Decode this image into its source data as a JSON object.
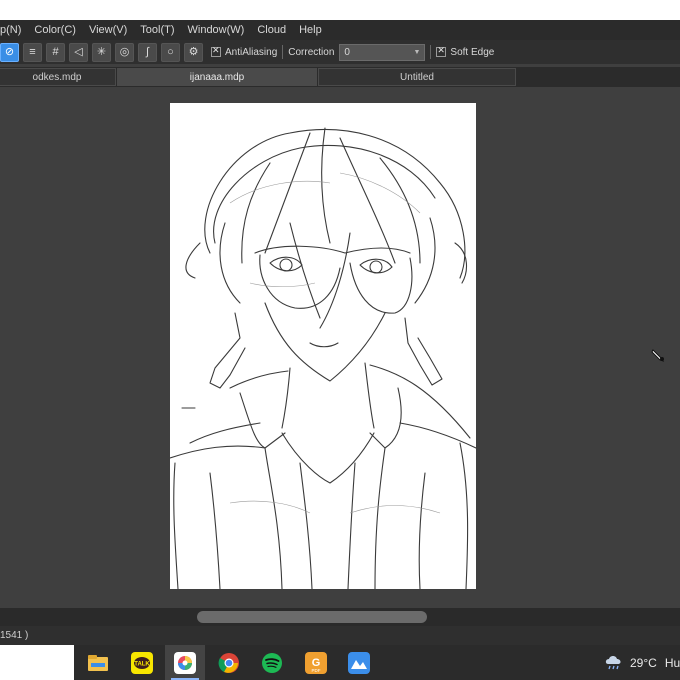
{
  "menu": [
    "p(N)",
    "Color(C)",
    "View(V)",
    "Tool(T)",
    "Window(W)",
    "Cloud",
    "Help"
  ],
  "toolbar": {
    "tool_icons": [
      "snap-off-icon",
      "parallel-snap-icon",
      "grid-snap-icon",
      "perspective-snap-icon",
      "radial-snap-icon",
      "concentric-snap-icon",
      "curve-snap-icon",
      "circle-snap-icon",
      "settings-icon"
    ],
    "antialiasing_label": "AntiAliasing",
    "correction_label": "Correction",
    "correction_value": "0",
    "soft_edge_label": "Soft Edge"
  },
  "tabs": [
    {
      "label": "odkes.mdp",
      "active": false
    },
    {
      "label": "ijanaaa.mdp",
      "active": true
    },
    {
      "label": "Untitled",
      "active": false
    }
  ],
  "status": {
    "text": "1541 )"
  },
  "taskbar": {
    "apps": [
      {
        "name": "file-explorer-icon",
        "color": "#f2c14e"
      },
      {
        "name": "kakaotalk-icon",
        "label": "TALK",
        "color": "#f7e600"
      },
      {
        "name": "medibang-icon",
        "color": "#ffffff",
        "active": true
      },
      {
        "name": "chrome-icon",
        "color": "#db4437"
      },
      {
        "name": "spotify-icon",
        "color": "#1db954"
      },
      {
        "name": "pdf-app-icon",
        "label": "PDF",
        "color": "#f0a030"
      },
      {
        "name": "photos-app-icon",
        "color": "#3b8eea"
      }
    ],
    "weather": {
      "temp": "29°C",
      "location": "Hu"
    }
  },
  "colors": {
    "accent": "#3a8ee6",
    "canvas_bg": "#3f3f3f",
    "panel": "#2b2b2b"
  }
}
